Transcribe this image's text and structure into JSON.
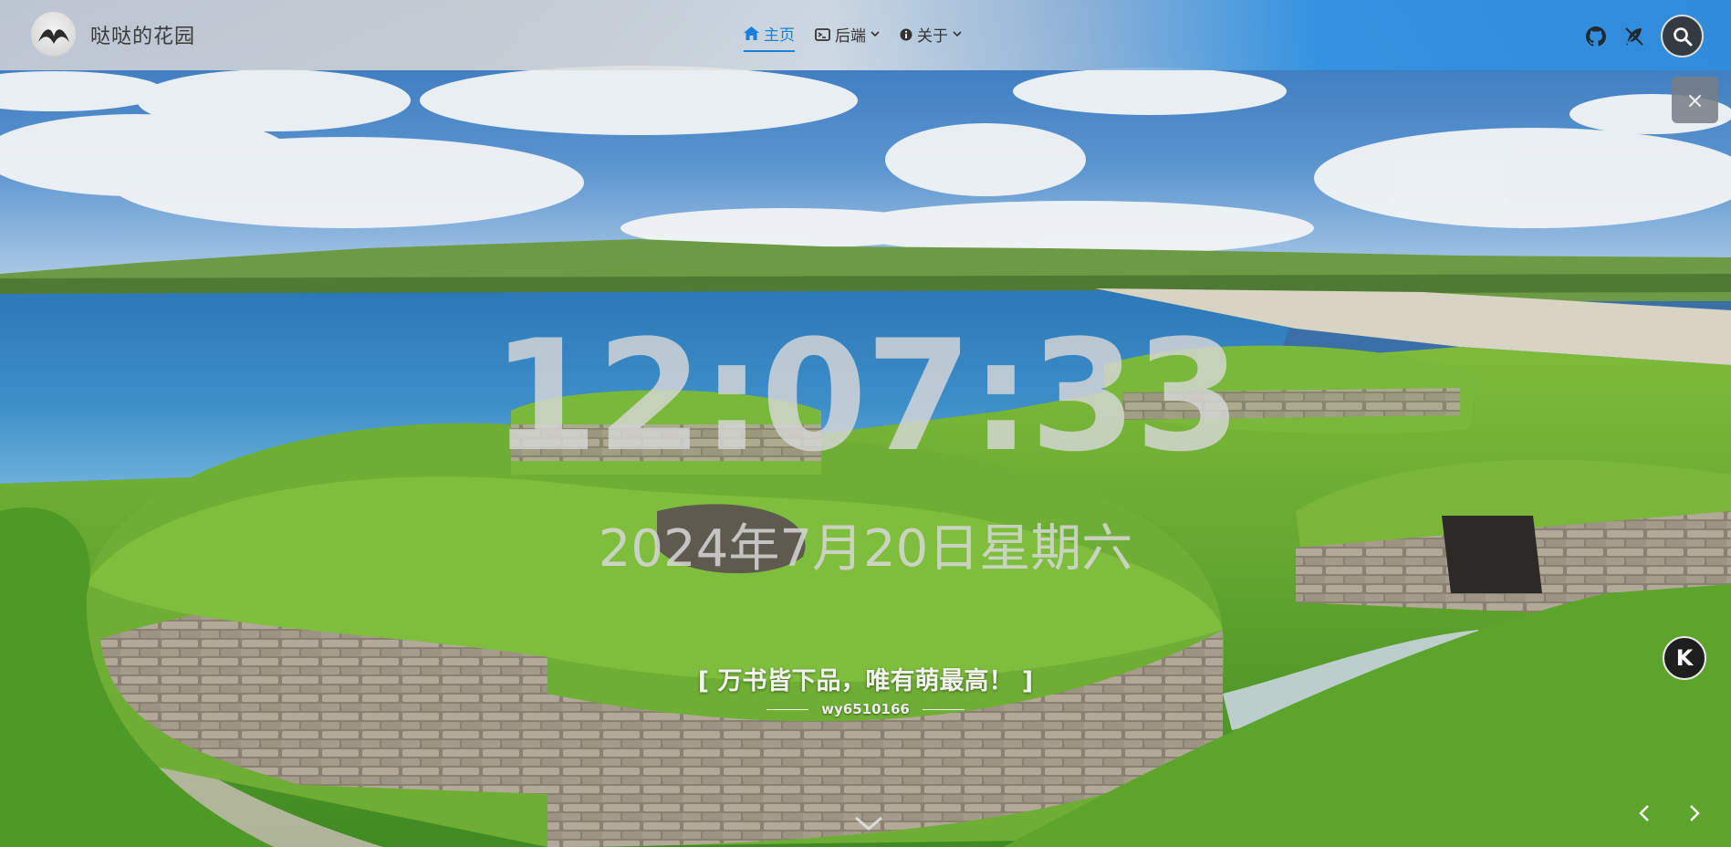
{
  "header": {
    "site_title": "哒哒的花园",
    "menu": [
      {
        "label": "主页",
        "icon": "home-icon",
        "active": true
      },
      {
        "label": "后端",
        "icon": "terminal-icon",
        "has_dropdown": true
      },
      {
        "label": "关于",
        "icon": "info-icon",
        "has_dropdown": true
      }
    ],
    "tools": [
      "github-icon",
      "feather-icon",
      "search-icon"
    ]
  },
  "hero": {
    "time": "12:07:33",
    "date": "2024年7月20日星期六",
    "quote": "[ 万书皆下品，唯有萌最高！ ]",
    "author": "wy6510166"
  },
  "controls": {
    "close": "×",
    "badge": "K",
    "prev": "‹",
    "next": "›"
  },
  "colors": {
    "accent": "#1a7fdc",
    "nav_right": "#3090dc"
  }
}
